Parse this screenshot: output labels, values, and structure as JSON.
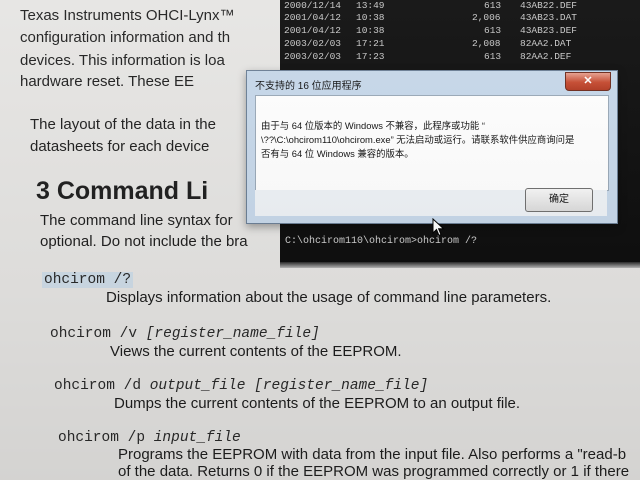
{
  "document": {
    "intro_lines": [
      "Texas Instruments OHCI-Lynx™",
      "configuration information and th",
      "devices.  This information is loa",
      "hardware reset.  These EE"
    ],
    "layout_lines": [
      "The layout of the data in the",
      "datasheets for each device"
    ],
    "section_heading": "3   Command Li",
    "syntax_lines": [
      "The command line syntax for",
      "optional.  Do not include the bra"
    ],
    "commands": [
      {
        "cmd": "ohcirom /?",
        "arg": "",
        "desc": "Displays information about the usage of command line parameters."
      },
      {
        "cmd": "ohcirom /v ",
        "arg": "[register_name_file]",
        "desc": "Views the current contents of the EEPROM."
      },
      {
        "cmd": "ohcirom /d ",
        "arg": "output_file [register_name_file]",
        "desc": "Dumps the current contents of the EEPROM to an output file."
      },
      {
        "cmd": "ohcirom /p ",
        "arg": "input_file",
        "desc": "Programs the EEPROM with data from the input file. Also performs a \"read-b"
      },
      {
        "cmd": "",
        "arg": "",
        "desc": "of the data.  Returns 0 if the EEPROM was programmed correctly or 1 if there"
      }
    ]
  },
  "console": {
    "rows": [
      {
        "date": "2000/12/14",
        "time": "13:49",
        "size": "613",
        "name": "43AB22.DEF"
      },
      {
        "date": "2001/04/12",
        "time": "10:38",
        "size": "2,006",
        "name": "43AB23.DAT"
      },
      {
        "date": "2001/04/12",
        "time": "10:38",
        "size": "613",
        "name": "43AB23.DEF"
      },
      {
        "date": "2003/02/03",
        "time": "17:21",
        "size": "2,008",
        "name": "82AA2.DAT"
      },
      {
        "date": "2003/02/03",
        "time": "17:23",
        "size": "613",
        "name": "82AA2.DEF"
      }
    ],
    "prompt": "C:\\ohcirom110\\ohcirom>ohcirom /?"
  },
  "dialog": {
    "title": "不支持的 16 位应用程序",
    "close_label": "✕",
    "message_lines": [
      "由于与 64 位版本的 Windows 不兼容，此程序或功能 “",
      "\\??\\C:\\ohcirom110\\ohcirom.exe” 无法启动或运行。请联系软件供应商询问是",
      "否有与 64 位 Windows 兼容的版本。"
    ],
    "ok_label": "确定"
  },
  "colors": {
    "console_bg": "#0e0e0e",
    "dialog_frame": "#c7d8ea",
    "close_button": "#c64a30",
    "highlight": "#cfdde8"
  }
}
